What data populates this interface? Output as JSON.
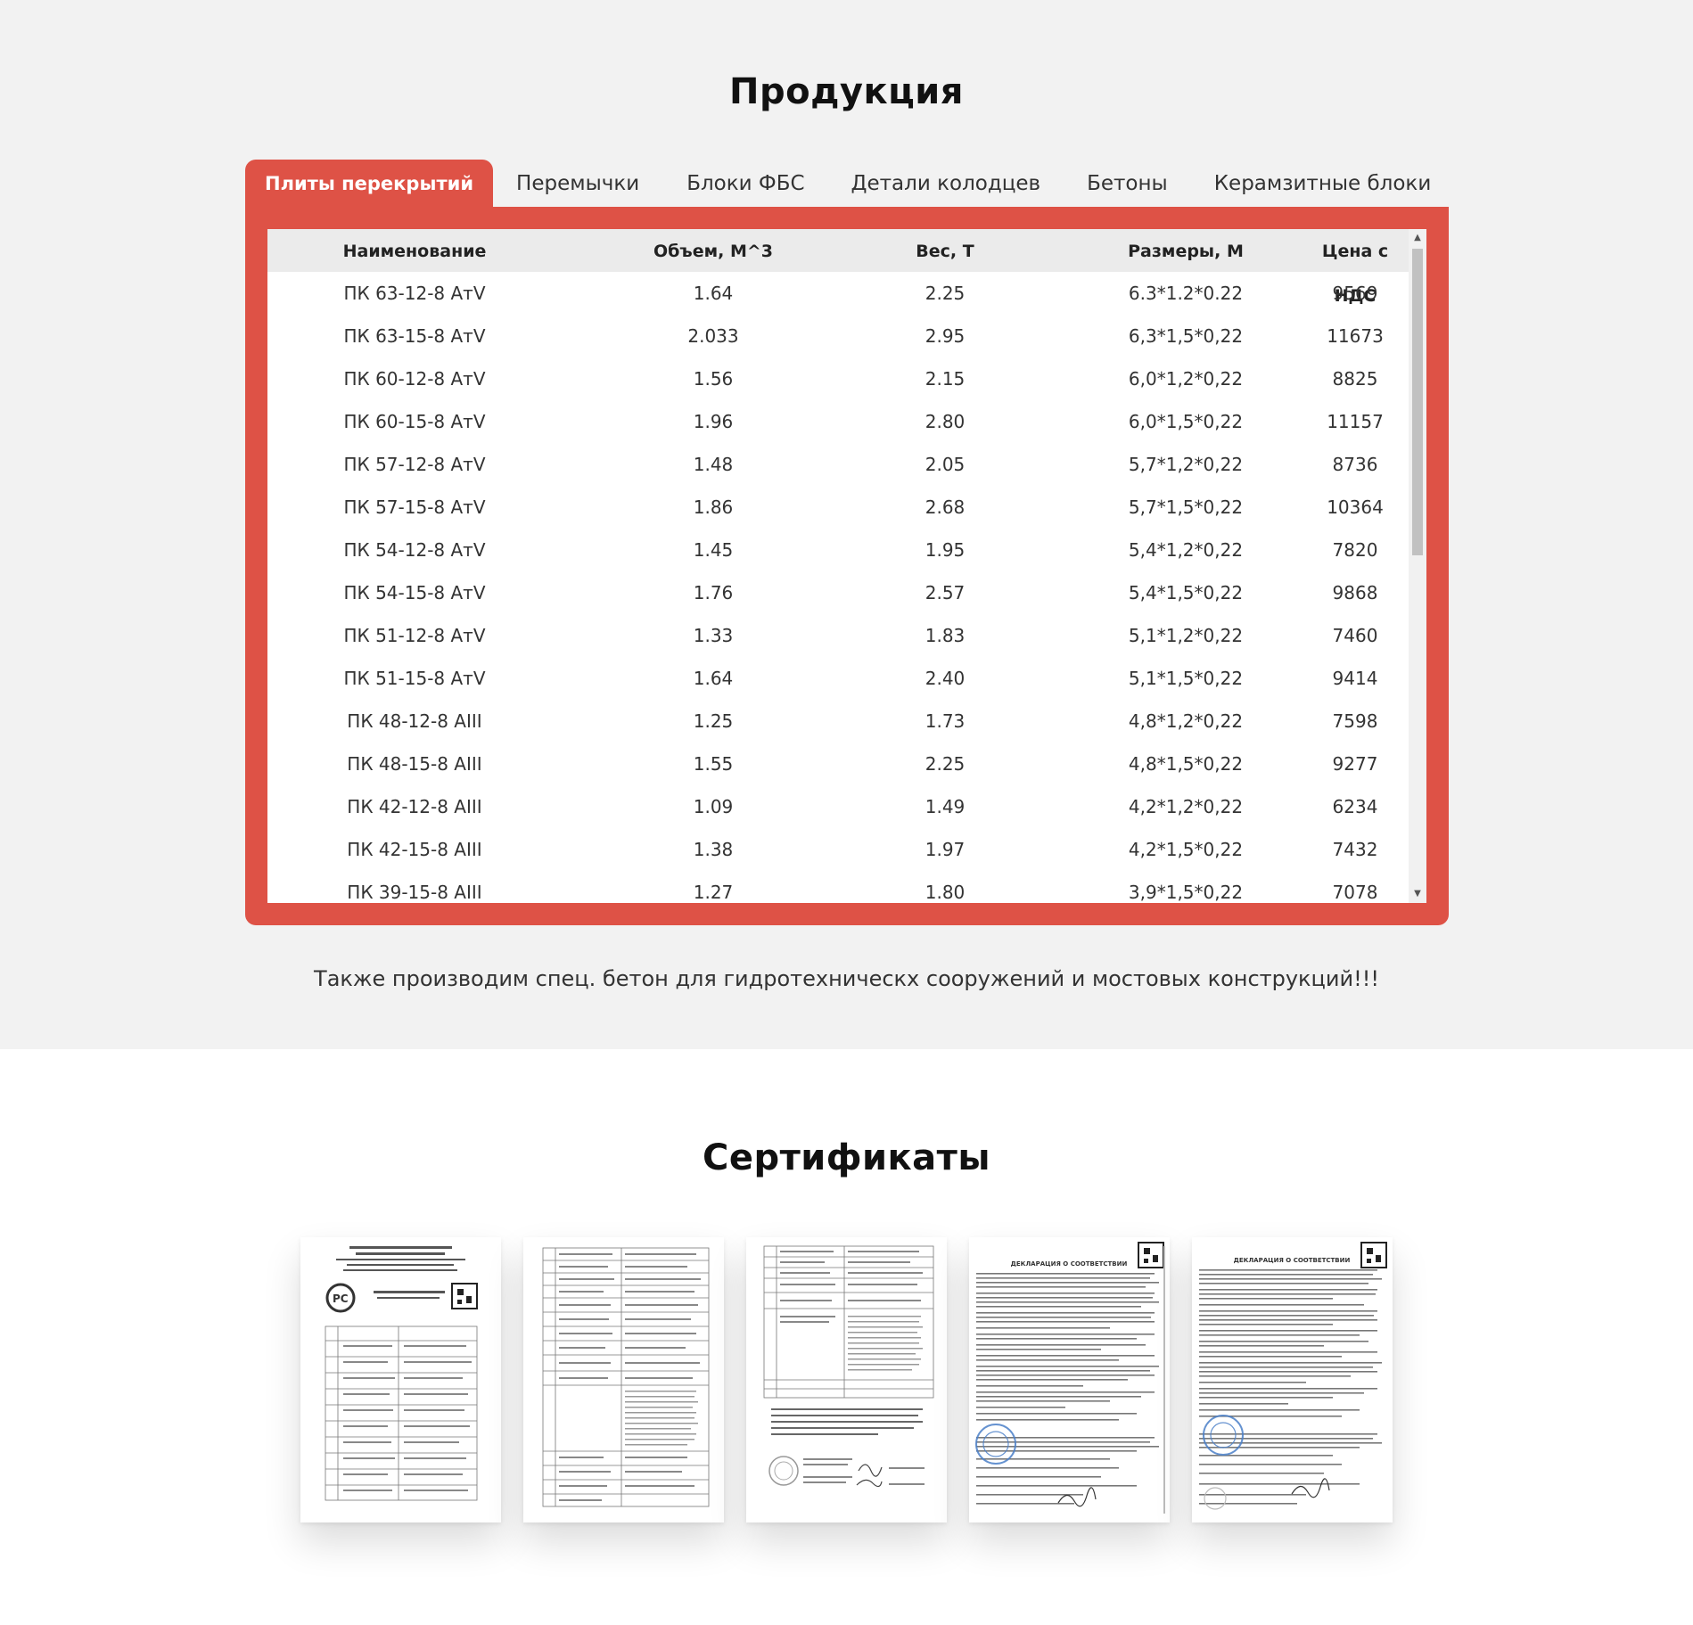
{
  "products": {
    "title": "Продукция",
    "tabs": [
      {
        "label": "Плиты перекрытий",
        "active": true
      },
      {
        "label": "Перемычки",
        "active": false
      },
      {
        "label": "Блоки ФБС",
        "active": false
      },
      {
        "label": "Детали колодцев",
        "active": false
      },
      {
        "label": "Бетоны",
        "active": false
      },
      {
        "label": "Керамзитные блоки",
        "active": false
      }
    ],
    "columns": [
      "Наименование",
      "Объем, М^3",
      "Вес, Т",
      "Размеры, М",
      "Цена с НДС"
    ],
    "rows": [
      [
        "ПК 63-12-8 АтV",
        "1.64",
        "2.25",
        "6.3*1.2*0.22",
        "9569"
      ],
      [
        "ПК 63-15-8 АтV",
        "2.033",
        "2.95",
        "6,3*1,5*0,22",
        "11673"
      ],
      [
        "ПК 60-12-8 АтV",
        "1.56",
        "2.15",
        "6,0*1,2*0,22",
        "8825"
      ],
      [
        "ПК 60-15-8 АтV",
        "1.96",
        "2.80",
        "6,0*1,5*0,22",
        "11157"
      ],
      [
        "ПК 57-12-8 АтV",
        "1.48",
        "2.05",
        "5,7*1,2*0,22",
        "8736"
      ],
      [
        "ПК 57-15-8 АтV",
        "1.86",
        "2.68",
        "5,7*1,5*0,22",
        "10364"
      ],
      [
        "ПК 54-12-8 АтV",
        "1.45",
        "1.95",
        "5,4*1,2*0,22",
        "7820"
      ],
      [
        "ПК 54-15-8 АтV",
        "1.76",
        "2.57",
        "5,4*1,5*0,22",
        "9868"
      ],
      [
        "ПК 51-12-8 АтV",
        "1.33",
        "1.83",
        "5,1*1,2*0,22",
        "7460"
      ],
      [
        "ПК 51-15-8 АтV",
        "1.64",
        "2.40",
        "5,1*1,5*0,22",
        "9414"
      ],
      [
        "ПК 48-12-8 АIII",
        "1.25",
        "1.73",
        "4,8*1,2*0,22",
        "7598"
      ],
      [
        "ПК 48-15-8 АIII",
        "1.55",
        "2.25",
        "4,8*1,5*0,22",
        "9277"
      ],
      [
        "ПК 42-12-8 АIII",
        "1.09",
        "1.49",
        "4,2*1,2*0,22",
        "6234"
      ],
      [
        "ПК 42-15-8 АIII",
        "1.38",
        "1.97",
        "4,2*1,5*0,22",
        "7432"
      ],
      [
        "ПК 39-15-8 АIII",
        "1.27",
        "1.80",
        "3,9*1,5*0,22",
        "7078"
      ]
    ],
    "note": "Также производим спец. бетон для гидротехническх сооружений и мостовых конструкций!!!"
  },
  "certificates": {
    "title": "Сертификаты",
    "items": [
      {
        "kind": "certificate-with-logo"
      },
      {
        "kind": "table-document"
      },
      {
        "kind": "document-with-stamp"
      },
      {
        "kind": "declaration",
        "heading": "ДЕКЛАРАЦИЯ О СООТВЕТСТВИИ"
      },
      {
        "kind": "declaration",
        "heading": "ДЕКЛАРАЦИЯ О СООТВЕТСТВИИ"
      }
    ]
  },
  "colors": {
    "accent": "#de5246",
    "section_bg": "#f2f2f2",
    "header_row_bg": "#ebebeb",
    "stamp_blue": "#4a7fc8"
  },
  "icons": {
    "scroll_up": "triangle-up-icon",
    "scroll_down": "triangle-down-icon"
  }
}
